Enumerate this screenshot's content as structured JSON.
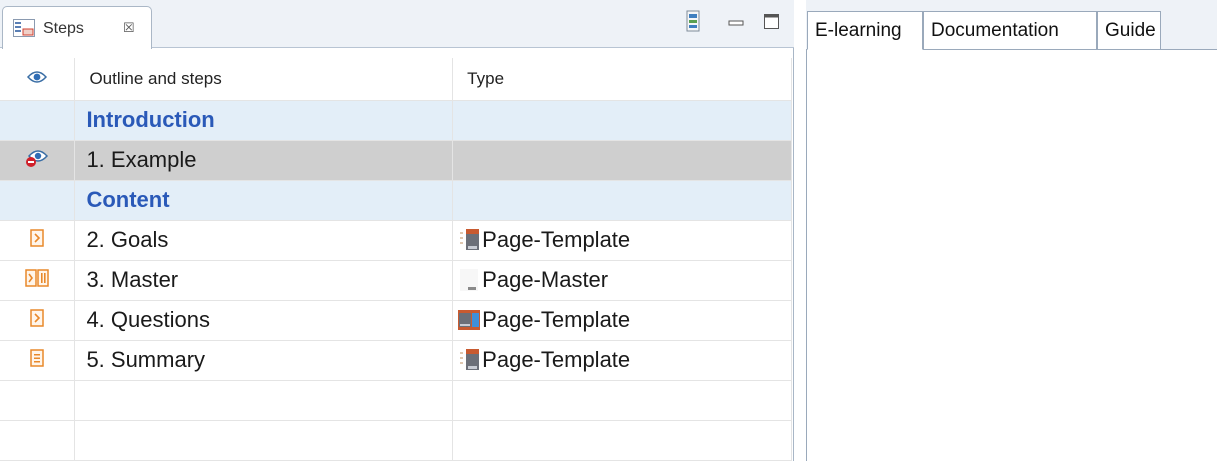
{
  "steps_view": {
    "title": "Steps",
    "close_glyph": "☒",
    "icons": {
      "tab": "steps-view-icon",
      "menu": "view-menu-icon",
      "minimize": "minimize-icon",
      "maximize": "maximize-icon"
    },
    "columns": {
      "visibility": "eye-icon",
      "outline": "Outline and steps",
      "type": "Type"
    },
    "rows": [
      {
        "kind": "section",
        "name": "Introduction",
        "type": ""
      },
      {
        "kind": "step",
        "icon": "eye-hidden-icon",
        "name": "1. Example",
        "type": "",
        "selected": true
      },
      {
        "kind": "section",
        "name": "Content",
        "type": ""
      },
      {
        "kind": "step",
        "icon": "step-page-icon",
        "name": "2. Goals",
        "type": "Page-Template",
        "type_icon": "template-thumb-icon"
      },
      {
        "kind": "step",
        "icon": "step-master-icon",
        "name": "3. Master",
        "type": "Page-Master",
        "type_icon": "master-thumb-icon"
      },
      {
        "kind": "step",
        "icon": "step-page-icon",
        "name": "4. Questions",
        "type": "Page-Template",
        "type_icon": "questions-thumb-icon"
      },
      {
        "kind": "step",
        "icon": "step-summary-icon",
        "name": "5. Summary",
        "type": "Page-Template",
        "type_icon": "template-thumb-icon"
      }
    ],
    "empty_rows": 2
  },
  "right_view": {
    "tabs": [
      {
        "label": "E-learning",
        "active": true
      },
      {
        "label": "Documentation",
        "active": false
      },
      {
        "label": "Guide",
        "active": false
      }
    ]
  },
  "colors": {
    "section_bg": "#e3eef8",
    "section_text": "#2a59b8",
    "selected_bg": "#cfcfcf",
    "step_icon": "#e8882a"
  }
}
